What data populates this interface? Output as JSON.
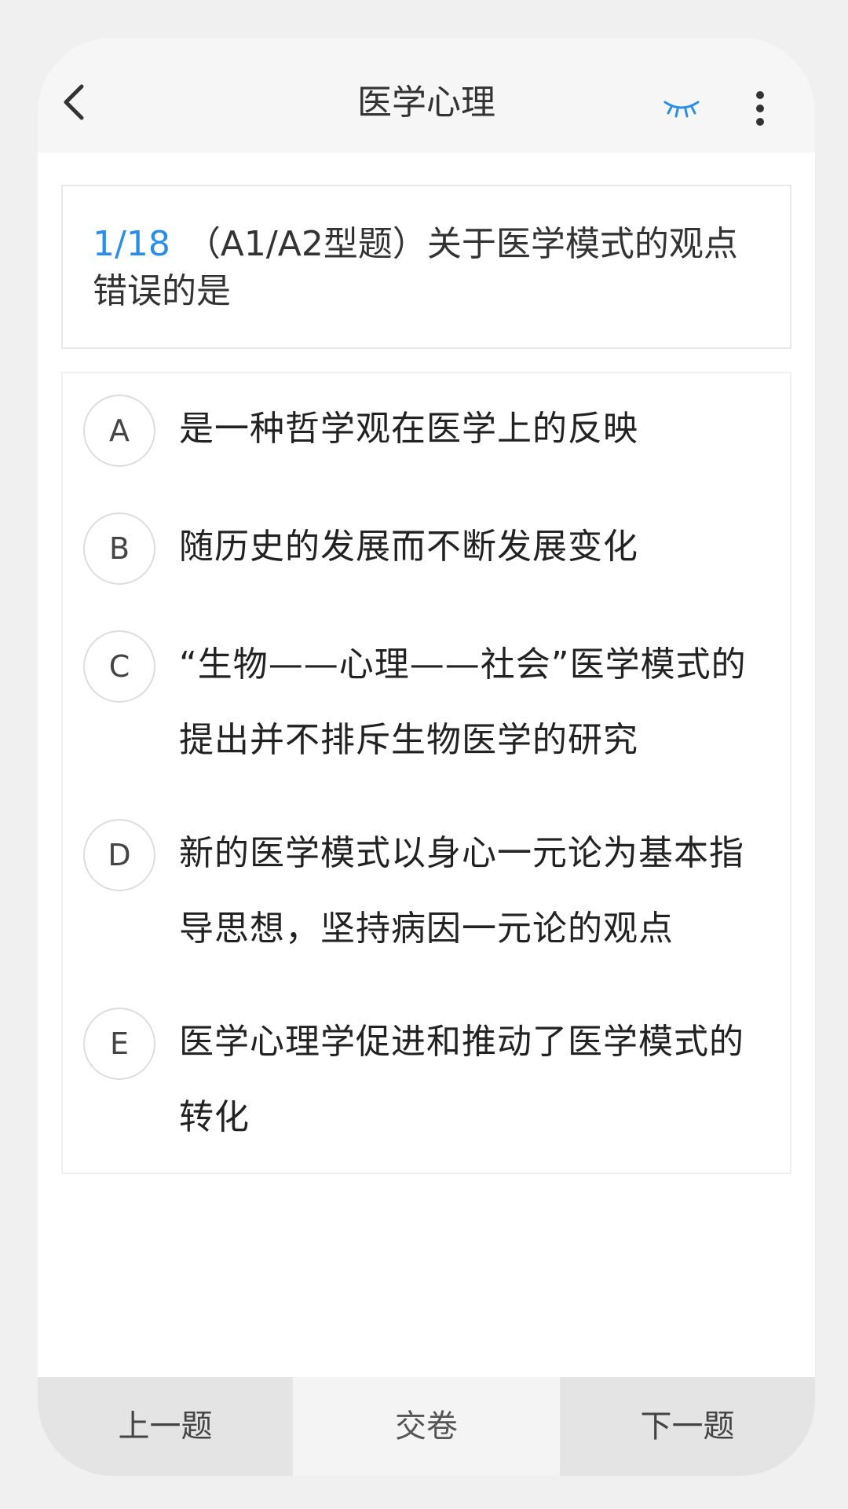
{
  "header": {
    "title": "医学心理",
    "back_icon": "chevron-left-icon",
    "eye_icon": "eye-closed-icon",
    "more_icon": "more-vertical-icon",
    "accent_color": "#2a8ee8"
  },
  "question": {
    "index": "1/18",
    "text": "（A1/A2型题）关于医学模式的观点错误的是"
  },
  "options": [
    {
      "letter": "A",
      "text": "是一种哲学观在医学上的反映"
    },
    {
      "letter": "B",
      "text": "随历史的发展而不断发展变化"
    },
    {
      "letter": "C",
      "text": "“生物——心理——社会”医学模式的提出并不排斥生物医学的研究"
    },
    {
      "letter": "D",
      "text": "新的医学模式以身心一元论为基本指导思想，坚持病因一元论的观点"
    },
    {
      "letter": "E",
      "text": "医学心理学促进和推动了医学模式的转化"
    }
  ],
  "bottom_bar": {
    "prev_label": "上一题",
    "submit_label": "交卷",
    "next_label": "下一题"
  }
}
